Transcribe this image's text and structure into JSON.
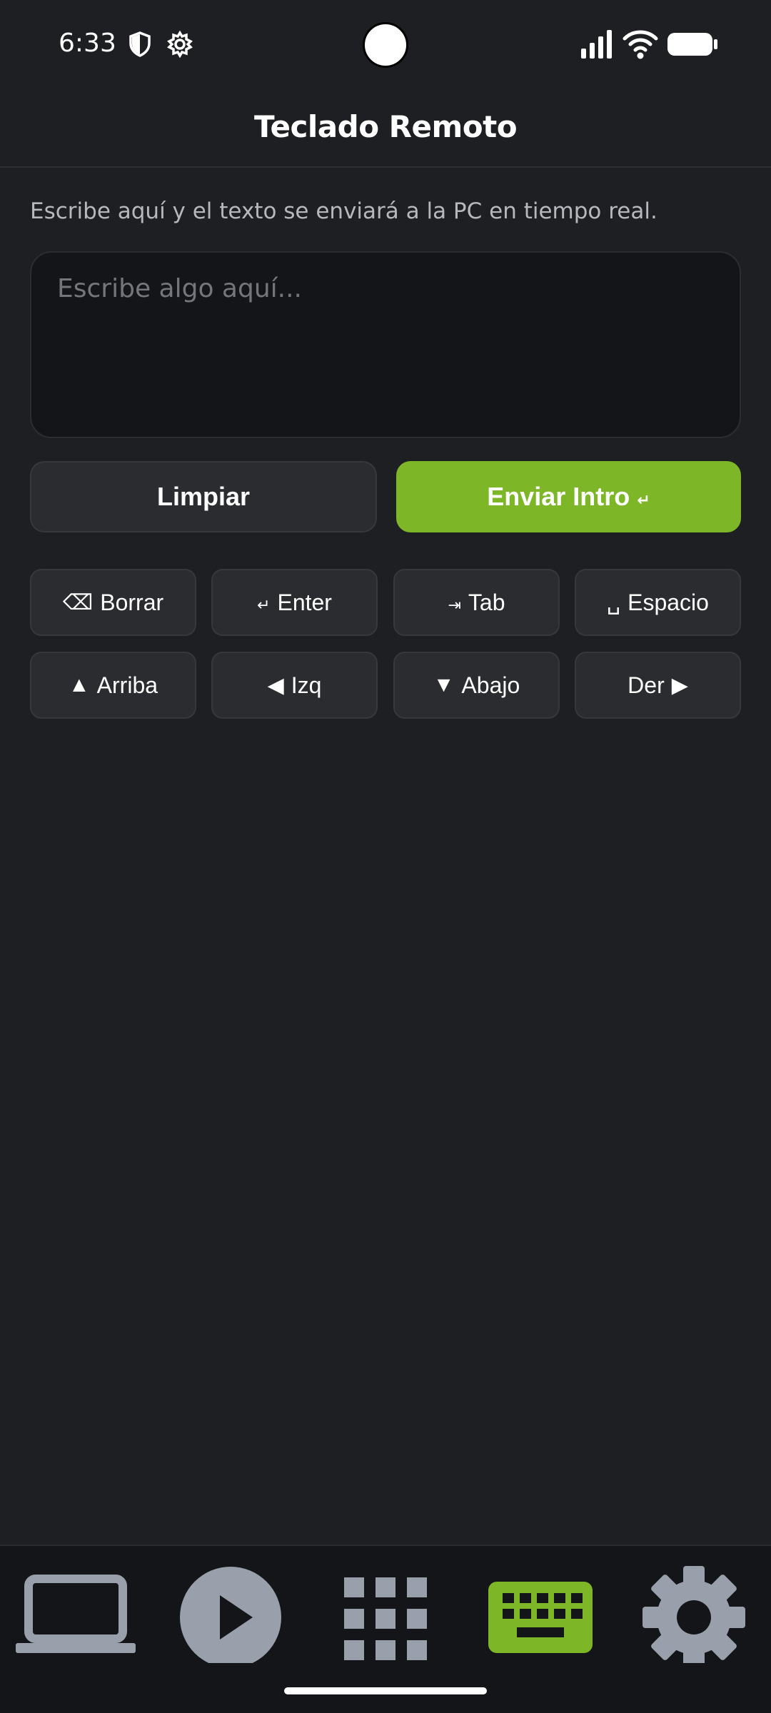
{
  "status_bar": {
    "time": "6:33",
    "icons": [
      "shield-icon",
      "gear-icon",
      "signal-icon",
      "wifi-icon",
      "battery-icon"
    ]
  },
  "header": {
    "title": "Teclado Remoto"
  },
  "main": {
    "description": "Escribe aquí y el texto se enviará a la PC en tiempo real.",
    "input": {
      "placeholder": "Escribe algo aquí...",
      "value": ""
    },
    "actions": {
      "clear_label": "Limpiar",
      "send_label": "Enviar Intro",
      "send_icon": "↵"
    },
    "keys": {
      "backspace": {
        "icon": "⌫",
        "label": "Borrar"
      },
      "enter": {
        "icon": "↵",
        "label": "Enter"
      },
      "tab": {
        "icon": "⇥",
        "label": "Tab"
      },
      "space": {
        "icon": "␣",
        "label": "Espacio"
      },
      "up": {
        "icon": "▲",
        "label": "Arriba"
      },
      "left": {
        "icon": "◀",
        "label": "Izq"
      },
      "down": {
        "icon": "▼",
        "label": "Abajo"
      },
      "right": {
        "label": "Der",
        "icon": "▶"
      }
    }
  },
  "bottom_nav": {
    "items": [
      {
        "icon": "laptop-icon",
        "active": false
      },
      {
        "icon": "play-icon",
        "active": false
      },
      {
        "icon": "grid-icon",
        "active": false
      },
      {
        "icon": "keyboard-icon",
        "active": true
      },
      {
        "icon": "gear-icon",
        "active": false
      }
    ]
  },
  "colors": {
    "background": "#1e1f22",
    "accent": "#7db728",
    "inactive_icon": "#9aa0ab",
    "surface": "#2a2c30"
  }
}
